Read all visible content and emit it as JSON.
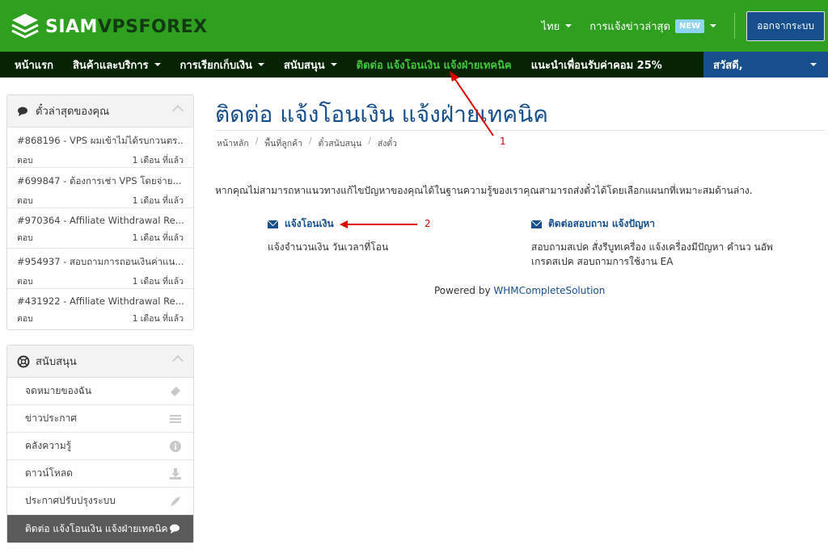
{
  "header": {
    "logo_white": "SIAM",
    "logo_dark": "VPSFOREX",
    "language": "ไทย",
    "news_label": "การแจ้งข่าวล่าสุด",
    "news_badge": "NEW",
    "logout_label": "ออกจากระบบ",
    "brand_color": "#2e9f1f",
    "accent_color": "#174f8c"
  },
  "nav": {
    "items": [
      {
        "label": "หน้าแรก"
      },
      {
        "label": "สินค้าและบริการ"
      },
      {
        "label": "การเรียกเก็บเงิน"
      },
      {
        "label": "สนับสนุน"
      },
      {
        "label": "ติดต่อ แจ้งโอนเงิน แจ้งฝ่ายเทคนิค"
      },
      {
        "label": "แนะนำเพื่อนรับค่าคอม 25%"
      }
    ],
    "user_label": "สวัสดี,"
  },
  "sidebar": {
    "recent_title": "ตั๋วล่าสุดของคุณ",
    "tickets": [
      {
        "title": "#868196 - VPS ผมเข้าไม่ได้รบกวนตร...",
        "status": "ตอบ",
        "time": "1 เดือน ที่แล้ว"
      },
      {
        "title": "#699847 - ต้องการเช่า VPS โดยจ่าย...",
        "status": "ตอบ",
        "time": "1 เดือน ที่แล้ว"
      },
      {
        "title": "#970364 - Affiliate Withdrawal Re...",
        "status": "ตอบ",
        "time": "1 เดือน ที่แล้ว"
      },
      {
        "title": "#954937 - สอบถามการถอนเงินค่าแน...",
        "status": "ตอบ",
        "time": "1 เดือน ที่แล้ว"
      },
      {
        "title": "#431922 - Affiliate Withdrawal Re...",
        "status": "ตอบ",
        "time": "1 เดือน ที่แล้ว"
      }
    ],
    "support_title": "สนับสนุน",
    "support_items": [
      {
        "label": "จดหมายของฉัน",
        "icon": "ticket-icon"
      },
      {
        "label": "ข่าวประกาศ",
        "icon": "list-icon"
      },
      {
        "label": "คลังความรู้",
        "icon": "info-icon"
      },
      {
        "label": "ดาวน์โหลด",
        "icon": "download-icon"
      },
      {
        "label": "ประกาศปรับปรุงระบบ",
        "icon": "rocket-icon"
      },
      {
        "label": "ติดต่อ แจ้งโอนเงิน แจ้งฝ่ายเทคนิค",
        "icon": "comments-icon"
      }
    ]
  },
  "main": {
    "title": "ติดต่อ แจ้งโอนเงิน แจ้งฝ่ายเทคนิค",
    "breadcrumb": [
      "หน้าหลัก",
      "พื้นที่ลูกค้า",
      "ตั๋วสนับสนุน",
      "ส่งตั๋ว"
    ],
    "intro": "หากคุณไม่สามารถหาแนวทางแก้ไขปัญหาของคุณได้ในฐานความรู้ของเราคุณสามารถส่งตั๋วได้โดยเลือกแผนกที่เหมาะสมด้านล่าง.",
    "departments": [
      {
        "name": "แจ้งโอนเงิน",
        "desc": "แจ้งจำนวนเงิน วันเวลาที่โอน"
      },
      {
        "name": "ติดต่อสอบถาม แจ้งปัญหา",
        "desc": "สอบถามสเปค สั่งรีบูทเครื่อง แจ้งเครื่องมีปัญหา คำนว นอัพเกรดสเปค สอบถามการใช้งาน EA"
      }
    ],
    "powered_by": "Powered by",
    "powered_link": "WHMCompleteSolution"
  },
  "annotations": {
    "marker_1": "1",
    "marker_2": "2",
    "color": "#dd0000"
  }
}
